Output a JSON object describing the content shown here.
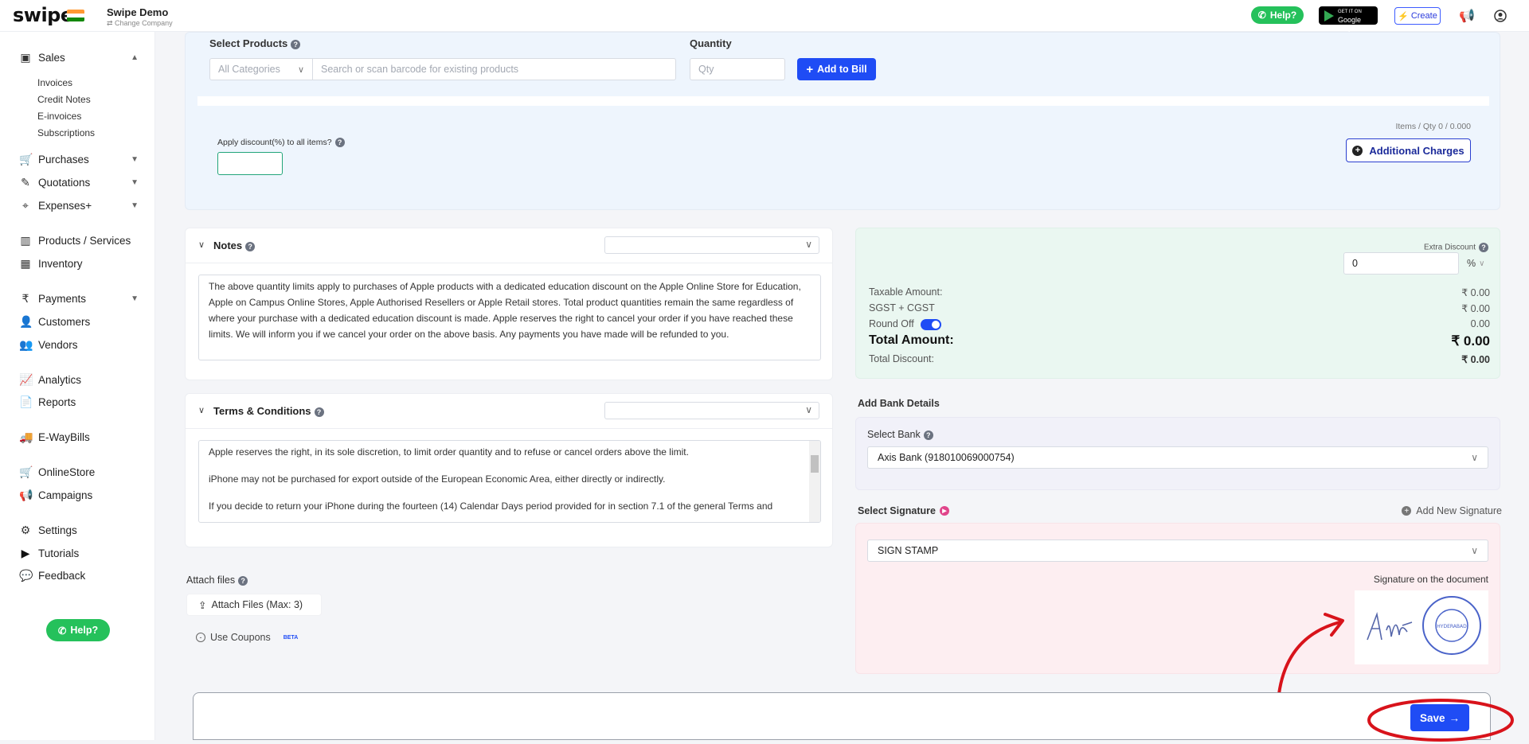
{
  "topbar": {
    "logo": "swipe",
    "company_name": "Swipe Demo",
    "change_company": "⇄ Change Company",
    "help_label": "Help?",
    "gplay_small": "GET IT ON",
    "gplay_label": "Google Play",
    "create_label": "Create"
  },
  "sidebar": {
    "sales": "Sales",
    "invoices": "Invoices",
    "credit_notes": "Credit Notes",
    "e_invoices": "E-invoices",
    "subscriptions": "Subscriptions",
    "purchases": "Purchases",
    "quotations": "Quotations",
    "expenses": "Expenses+",
    "products": "Products / Services",
    "inventory": "Inventory",
    "payments": "Payments",
    "customers": "Customers",
    "vendors": "Vendors",
    "analytics": "Analytics",
    "reports": "Reports",
    "ewaybills": "E-WayBills",
    "onlinestore": "OnlineStore",
    "campaigns": "Campaigns",
    "settings": "Settings",
    "tutorials": "Tutorials",
    "feedback": "Feedback",
    "help": "Help?"
  },
  "products": {
    "title": "Select Products",
    "quantity_label": "Quantity",
    "category": "All Categories",
    "search_placeholder": "Search or scan barcode for existing products",
    "qty_placeholder": "Qty",
    "add_to_bill": "Add to Bill",
    "items_qty": "Items / Qty 0 / 0.000",
    "discount_label": "Apply discount(%) to all items?",
    "additional_charges": "Additional Charges"
  },
  "notes": {
    "title": "Notes",
    "text": "The above quantity limits apply to purchases of Apple products with a dedicated education discount on the Apple Online Store for Education, Apple on Campus Online Stores, Apple Authorised Resellers or Apple Retail stores. Total product quantities remain the same regardless of where your purchase with a dedicated education discount is made. Apple reserves the right to cancel your order if you have reached these limits. We will inform you if we cancel your order on the above basis. Any payments you have made will be refunded to you."
  },
  "terms": {
    "title": "Terms & Conditions",
    "line1": "Apple reserves the right, in its sole discretion, to limit order quantity and to refuse or cancel orders above the limit.",
    "line2": "iPhone may not be purchased for export outside of the European Economic Area, either directly or indirectly.",
    "line3": "If you decide to return your iPhone during the fourteen (14) Calendar Days period provided for in section 7.1 of the general Terms and"
  },
  "attach": {
    "title": "Attach files",
    "button": "Attach Files (Max: 3)",
    "coupons": "Use Coupons",
    "beta": "BETA"
  },
  "summary": {
    "extra_discount_label": "Extra Discount",
    "extra_discount_value": "0",
    "discount_unit": "%",
    "taxable_label": "Taxable Amount:",
    "taxable_value": "₹ 0.00",
    "gst_label": "SGST + CGST",
    "gst_value": "₹ 0.00",
    "round_off_label": "Round Off",
    "round_off_value": "0.00",
    "total_label": "Total Amount:",
    "total_value": "₹ 0.00",
    "total_discount_label": "Total Discount:",
    "total_discount_value": "₹ 0.00"
  },
  "bank": {
    "section_label": "Add Bank Details",
    "select_label": "Select Bank",
    "selected": "Axis Bank (918010069000754)"
  },
  "signature": {
    "section_label": "Select Signature",
    "add_new": "Add New Signature",
    "selected": "SIGN STAMP",
    "on_document": "Signature on the document",
    "stamp_text": "HYDERABAD"
  },
  "footer": {
    "save_label": "Save"
  }
}
